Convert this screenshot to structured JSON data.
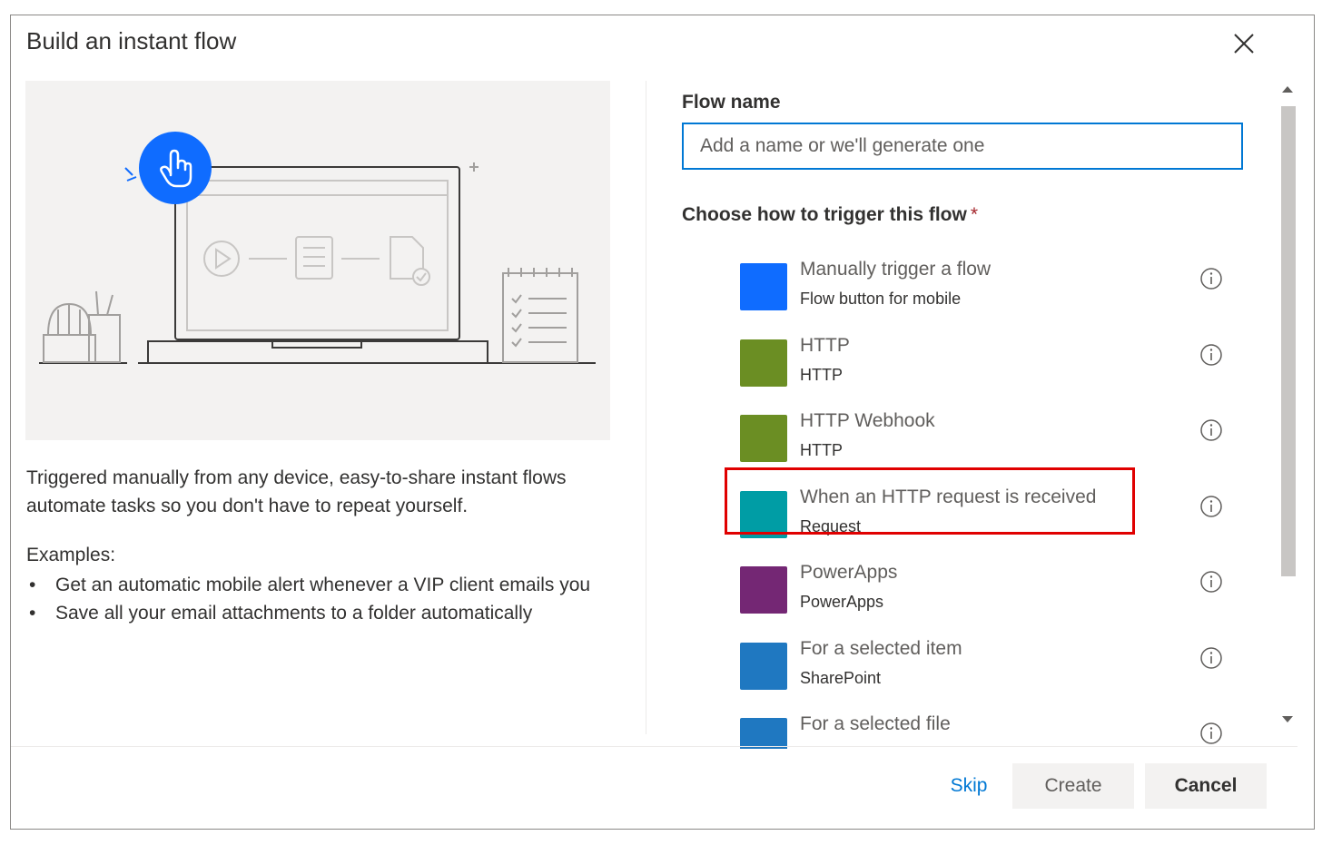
{
  "dialog": {
    "title": "Build an instant flow",
    "close_icon": "close-icon"
  },
  "left": {
    "illustration": "laptop-flow-illustration",
    "description": "Triggered manually from any device, easy-to-share instant flows automate tasks so you don't have to repeat yourself.",
    "examples_label": "Examples:",
    "examples": [
      "Get an automatic mobile alert whenever a VIP client emails you",
      "Save all your email attachments to a folder automatically"
    ]
  },
  "form": {
    "flow_name_label": "Flow name",
    "flow_name_placeholder": "Add a name or we'll generate one",
    "flow_name_value": "",
    "trigger_label": "Choose how to trigger this flow",
    "required_mark": "*"
  },
  "triggers": [
    {
      "name": "Manually trigger a flow",
      "sub": "Flow button for mobile",
      "color": "#0f6cff"
    },
    {
      "name": "HTTP",
      "sub": "HTTP",
      "color": "#6b8e23"
    },
    {
      "name": "HTTP Webhook",
      "sub": "HTTP",
      "color": "#6b8e23"
    },
    {
      "name": "When an HTTP request is received",
      "sub": "Request",
      "color": "#009da5"
    },
    {
      "name": "PowerApps",
      "sub": "PowerApps",
      "color": "#742774"
    },
    {
      "name": "For a selected item",
      "sub": "SharePoint",
      "color": "#1f78c1"
    },
    {
      "name": "For a selected file",
      "sub": "",
      "color": "#1f78c1"
    }
  ],
  "highlighted_trigger": "When an HTTP request is received",
  "highlight_color": "#e00000",
  "footer": {
    "skip": "Skip",
    "create": "Create",
    "cancel": "Cancel"
  },
  "colors": {
    "accent": "#0078d4",
    "hand_circle": "#0f6cff"
  }
}
